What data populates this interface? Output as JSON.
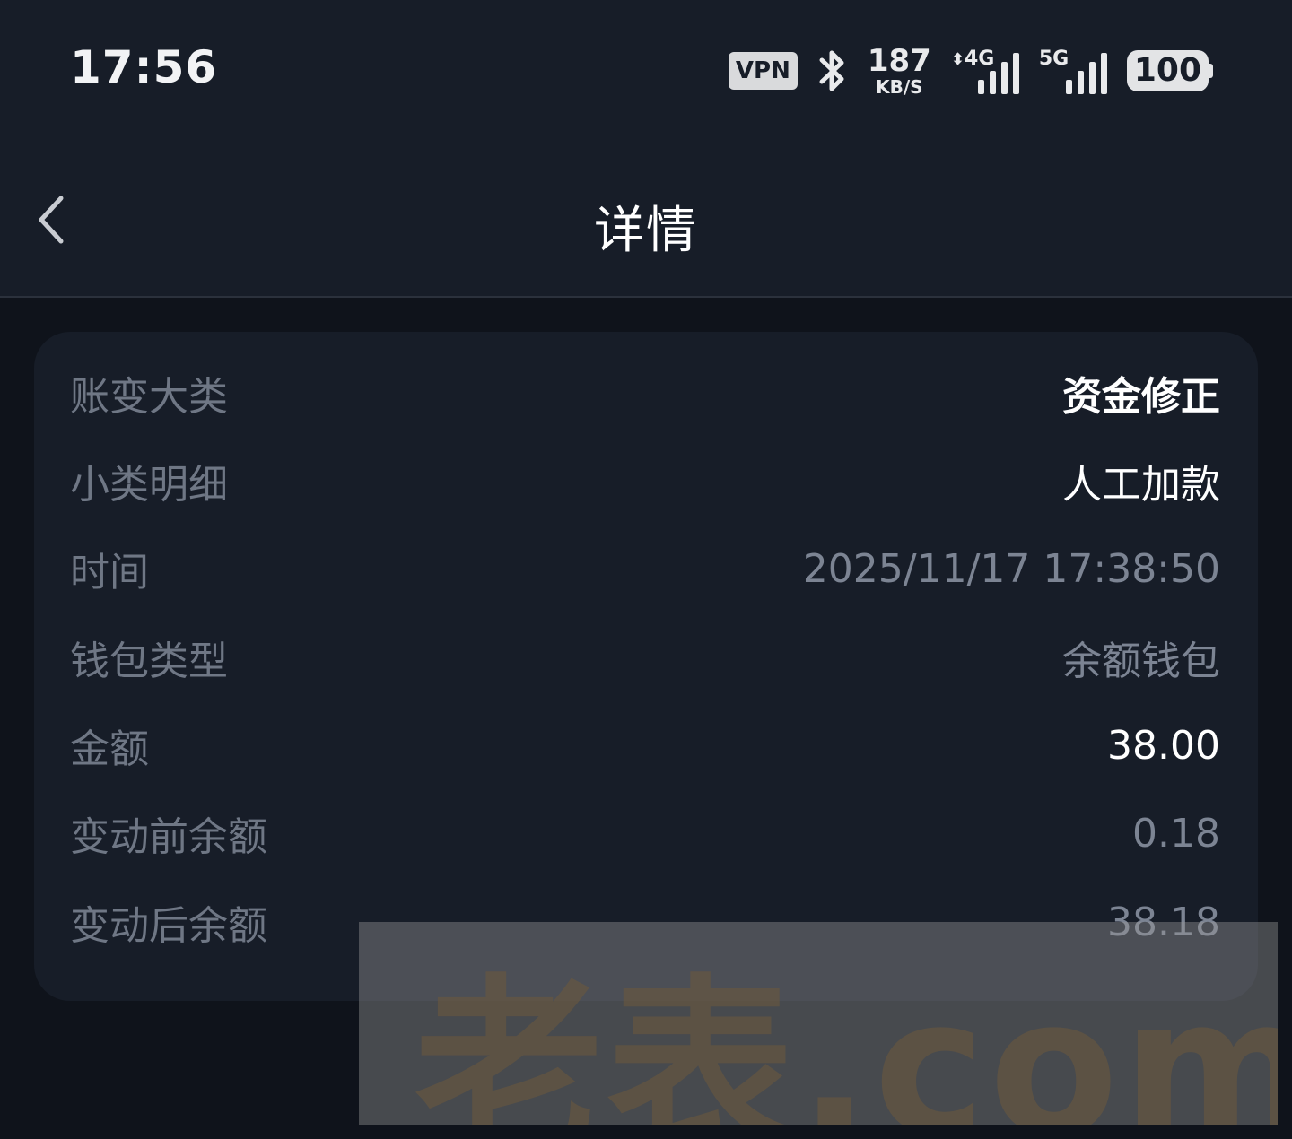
{
  "status_bar": {
    "time": "17:56",
    "vpn_label": "VPN",
    "speed_value": "187",
    "speed_unit": "KB/S",
    "signal_1_label": "4G",
    "signal_2_label": "5G",
    "battery": "100"
  },
  "header": {
    "title": "详情"
  },
  "details": {
    "rows": [
      {
        "label": "账变大类",
        "value": "资金修正"
      },
      {
        "label": "小类明细",
        "value": "人工加款"
      },
      {
        "label": "时间",
        "value": "2025/11/17 17:38:50"
      },
      {
        "label": "钱包类型",
        "value": "余额钱包"
      },
      {
        "label": "金额",
        "value": "38.00"
      },
      {
        "label": "变动前余额",
        "value": "0.18"
      },
      {
        "label": "变动后余额",
        "value": "38.18"
      }
    ]
  },
  "watermark": {
    "text": "老表.com"
  },
  "icons": {
    "back": "chevron-left-icon",
    "bluetooth": "bluetooth-icon"
  }
}
